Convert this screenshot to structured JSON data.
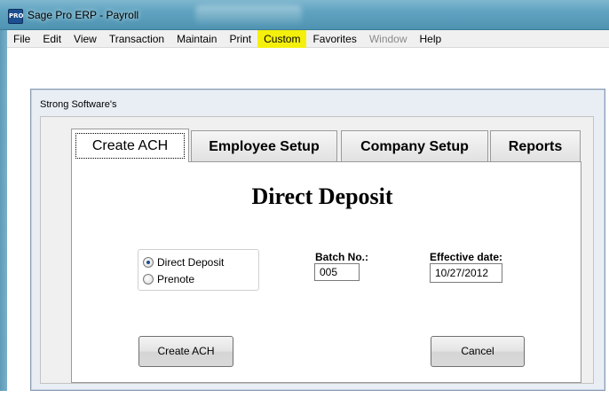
{
  "window": {
    "icon_text": "PRO",
    "title": "Sage Pro ERP - Payroll"
  },
  "menu": [
    {
      "label": "File"
    },
    {
      "label": "Edit"
    },
    {
      "label": "View"
    },
    {
      "label": "Transaction"
    },
    {
      "label": "Maintain"
    },
    {
      "label": "Print"
    },
    {
      "label": "Custom"
    },
    {
      "label": "Favorites"
    },
    {
      "label": "Window"
    },
    {
      "label": "Help"
    }
  ],
  "dialog": {
    "title": "Strong Software's"
  },
  "tabs": [
    {
      "label": "Create ACH"
    },
    {
      "label": "Employee Setup"
    },
    {
      "label": "Company Setup"
    },
    {
      "label": "Reports"
    }
  ],
  "panel": {
    "heading": "Direct Deposit",
    "options": [
      {
        "label": "Direct Deposit"
      },
      {
        "label": "Prenote"
      }
    ],
    "batch_label": "Batch No.:",
    "batch_value": "005",
    "date_label": "Effective date:",
    "date_value": "10/27/2012",
    "create_button": "Create ACH",
    "cancel_button": "Cancel"
  },
  "colors": {
    "highlight": "#f4f00c",
    "titlebar": "#5fa3c0"
  }
}
